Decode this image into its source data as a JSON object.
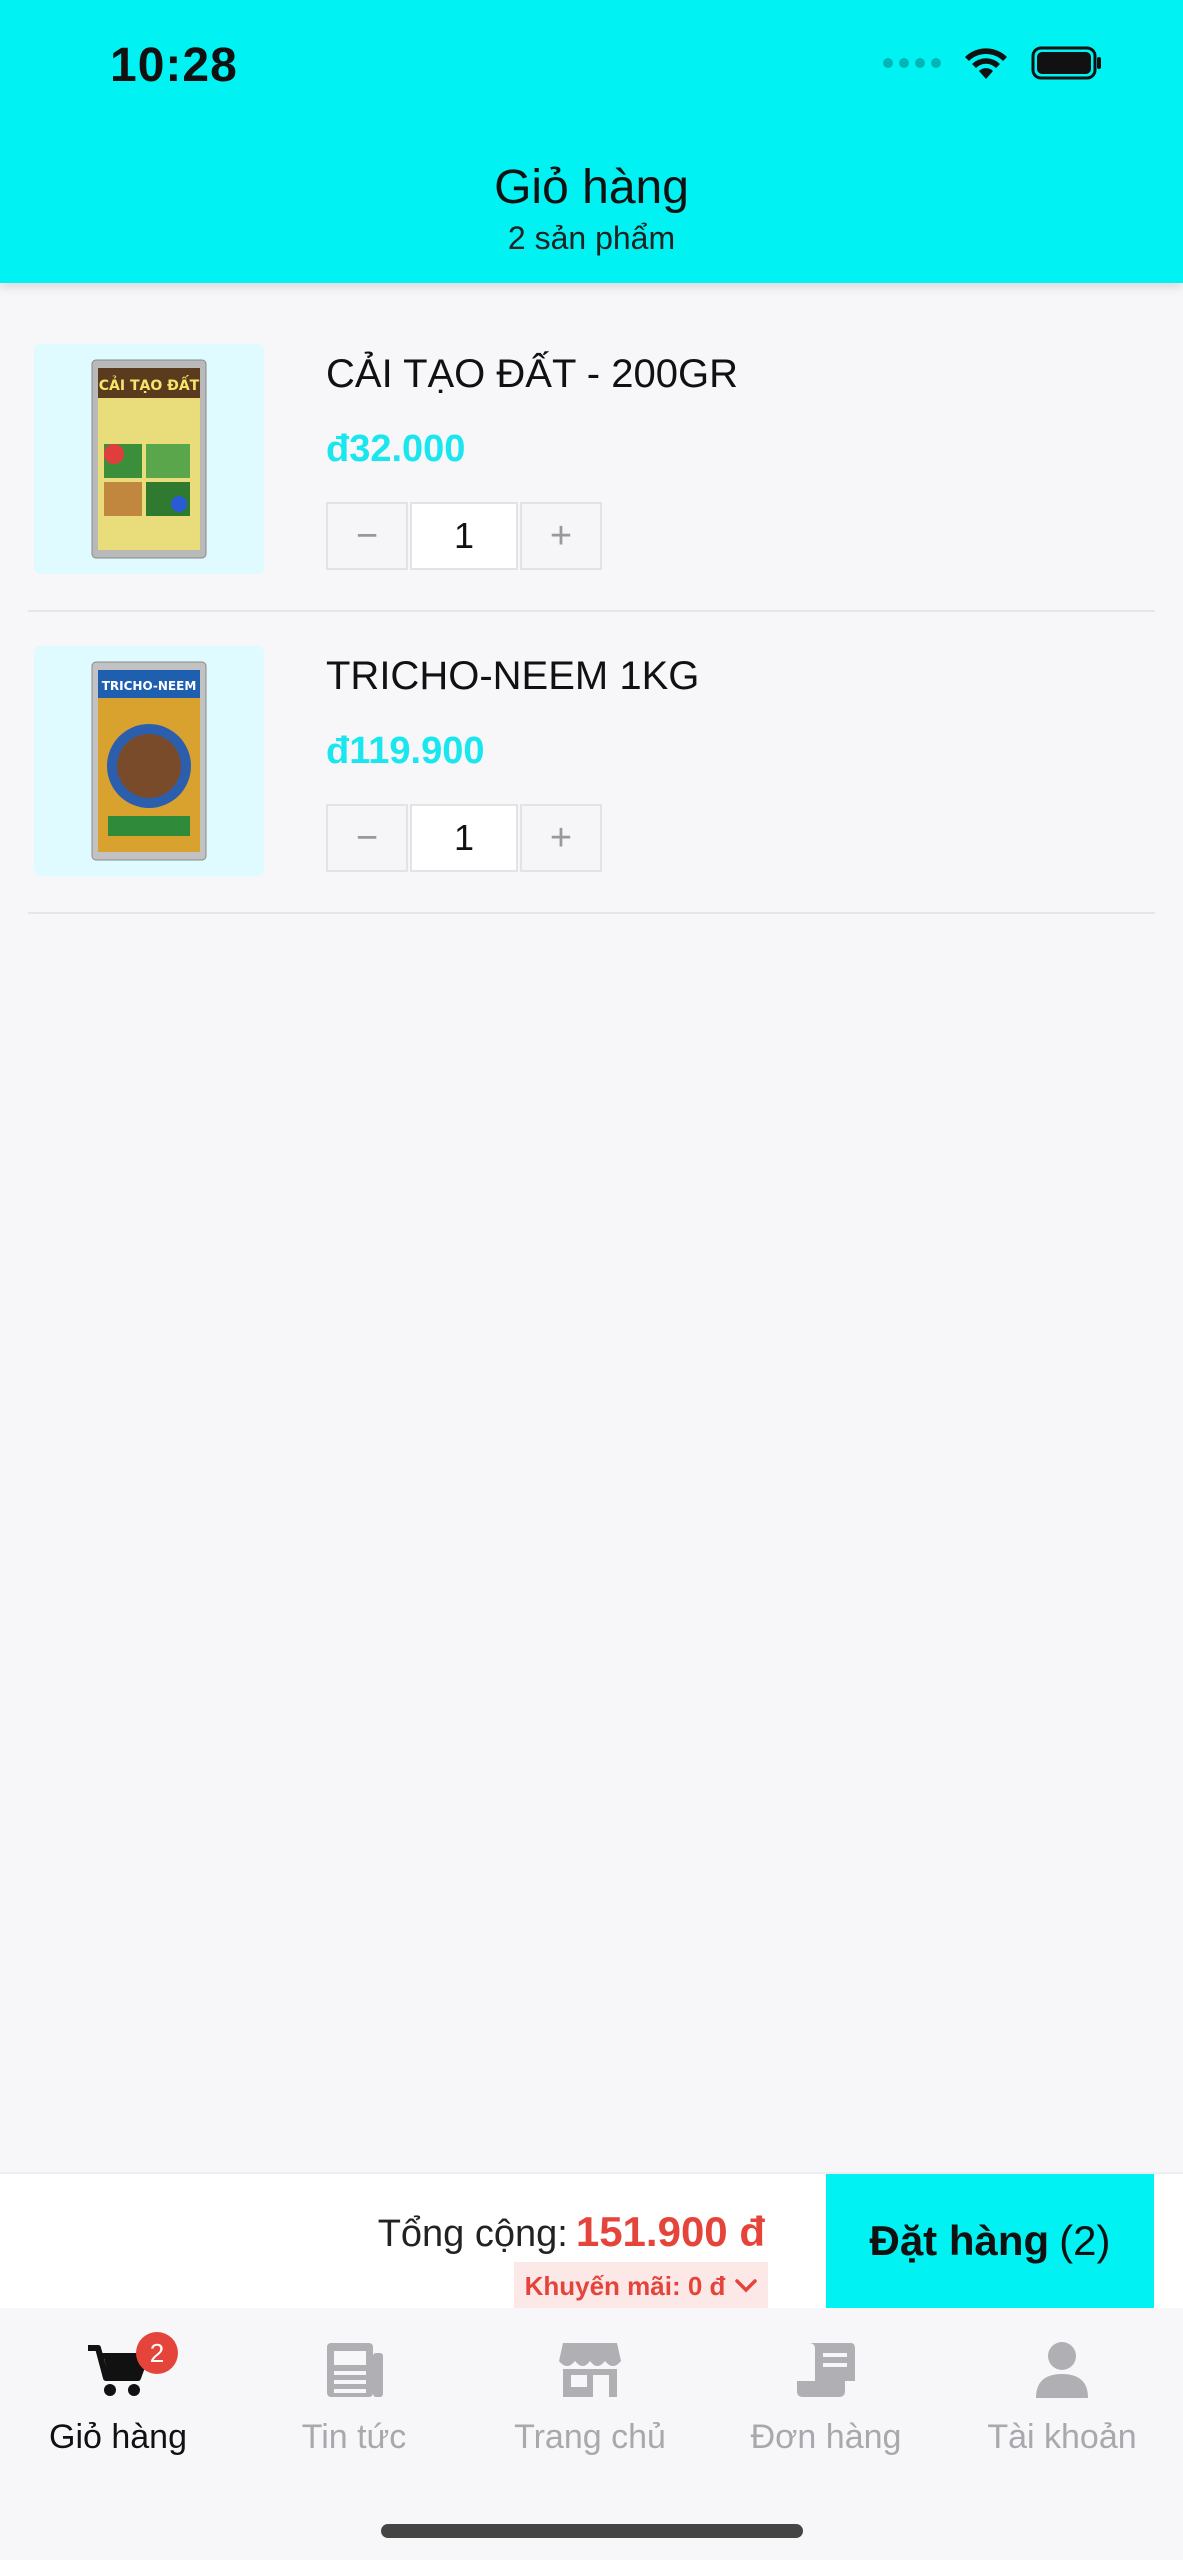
{
  "status_bar": {
    "time": "10:28"
  },
  "header": {
    "title": "Giỏ hàng",
    "subtitle": "2 sản phẩm"
  },
  "cart": {
    "items": [
      {
        "name": "CẢI TẠO ĐẤT - 200GR",
        "price": "đ32.000",
        "quantity": "1",
        "image_icon": "soil-improver-package"
      },
      {
        "name": "TRICHO-NEEM 1KG",
        "price": "đ119.900",
        "quantity": "1",
        "image_icon": "tricho-neem-package"
      }
    ],
    "minus_label": "−",
    "plus_label": "+"
  },
  "checkout": {
    "total_label": "Tổng cộng:",
    "total_amount": "151.900 đ",
    "promo_label": "Khuyến mãi: 0 đ",
    "order_button_label": "Đặt hàng",
    "order_button_count": "(2)"
  },
  "tabbar": {
    "tabs": [
      {
        "label": "Giỏ hàng",
        "icon": "cart-icon",
        "active": true,
        "badge": "2"
      },
      {
        "label": "Tin tức",
        "icon": "newspaper-icon",
        "active": false
      },
      {
        "label": "Trang chủ",
        "icon": "store-icon",
        "active": false
      },
      {
        "label": "Đơn hàng",
        "icon": "receipt-icon",
        "active": false
      },
      {
        "label": "Tài khoản",
        "icon": "user-icon",
        "active": false
      }
    ]
  },
  "colors": {
    "accent": "#00f2f2",
    "price": "#19e6ee",
    "total": "#e5443b"
  }
}
